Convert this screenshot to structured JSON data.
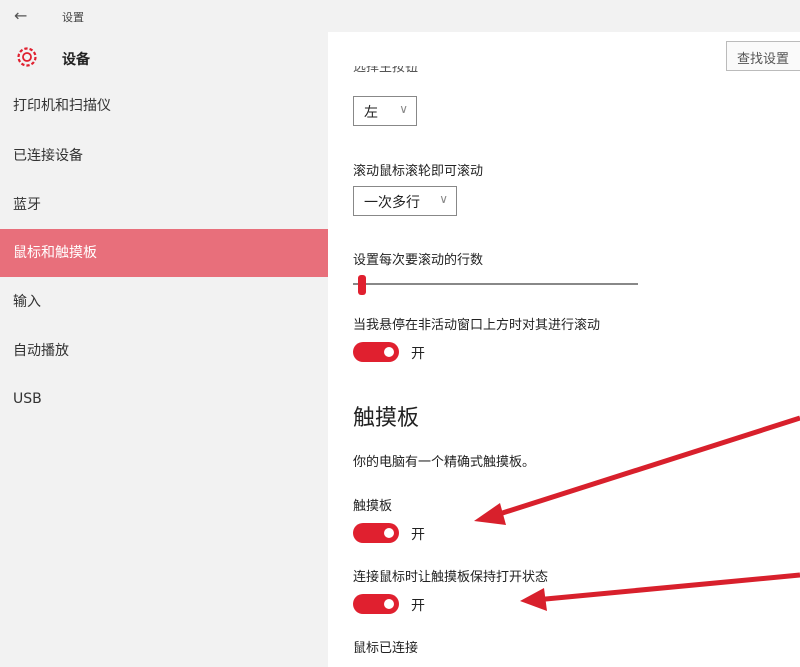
{
  "window": {
    "title": "设置"
  },
  "sidebar": {
    "title": "设备",
    "items": [
      {
        "label": "打印机和扫描仪",
        "active": false
      },
      {
        "label": "已连接设备",
        "active": false
      },
      {
        "label": "蓝牙",
        "active": false
      },
      {
        "label": "鼠标和触摸板",
        "active": true
      },
      {
        "label": "输入",
        "active": false
      },
      {
        "label": "自动播放",
        "active": false
      },
      {
        "label": "USB",
        "active": false
      }
    ]
  },
  "search": {
    "placeholder": "查找设置"
  },
  "main": {
    "cutoff_label": "选择主按钮",
    "primary_button": {
      "value": "左"
    },
    "scroll_wheel": {
      "label": "滚动鼠标滚轮即可滚动",
      "value": "一次多行"
    },
    "lines_to_scroll": {
      "label": "设置每次要滚动的行数",
      "value": 0.03
    },
    "inactive_scroll": {
      "label": "当我悬停在非活动窗口上方时对其进行滚动",
      "state": "开"
    },
    "touchpad": {
      "section_title": "触摸板",
      "description": "你的电脑有一个精确式触摸板。",
      "touchpad_toggle": {
        "label": "触摸板",
        "state": "开"
      },
      "keep_on_toggle": {
        "label": "连接鼠标时让触摸板保持打开状态",
        "state": "开"
      },
      "mouse_connected": "鼠标已连接"
    }
  },
  "colors": {
    "accent": "#e0202f",
    "nav_active": "#e86f7b",
    "sidebar_bg": "#f2f2f2"
  }
}
